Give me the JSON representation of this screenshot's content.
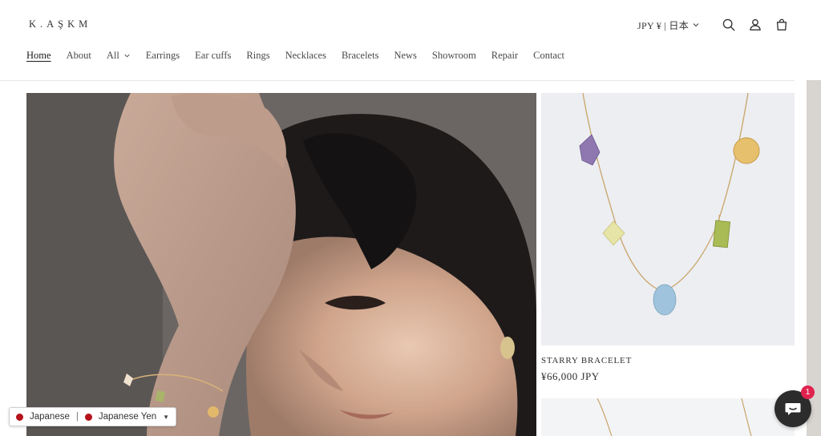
{
  "brand": {
    "logo_text": "K.AŞKM"
  },
  "header": {
    "currency_label": "JPY ¥ | 日本",
    "icons": [
      "search-icon",
      "account-icon",
      "cart-icon"
    ]
  },
  "nav": {
    "items": [
      {
        "label": "Home",
        "active": true
      },
      {
        "label": "About"
      },
      {
        "label": "All",
        "dropdown": true
      },
      {
        "label": "Earrings"
      },
      {
        "label": "Ear cuffs"
      },
      {
        "label": "Rings"
      },
      {
        "label": "Necklaces"
      },
      {
        "label": "Bracelets"
      },
      {
        "label": "News"
      },
      {
        "label": "Showroom"
      },
      {
        "label": "Repair"
      },
      {
        "label": "Contact"
      }
    ]
  },
  "featured_product": {
    "title": "STARRY BRACELET",
    "price": "¥66,000 JPY"
  },
  "locale_bar": {
    "language": "Japanese",
    "currency": "Japanese Yen"
  },
  "chat": {
    "badge_count": "1"
  },
  "colors": {
    "accent_badge": "#e0234e",
    "flag_red": "#b5121b",
    "chat_bg": "#2c2c2c"
  }
}
